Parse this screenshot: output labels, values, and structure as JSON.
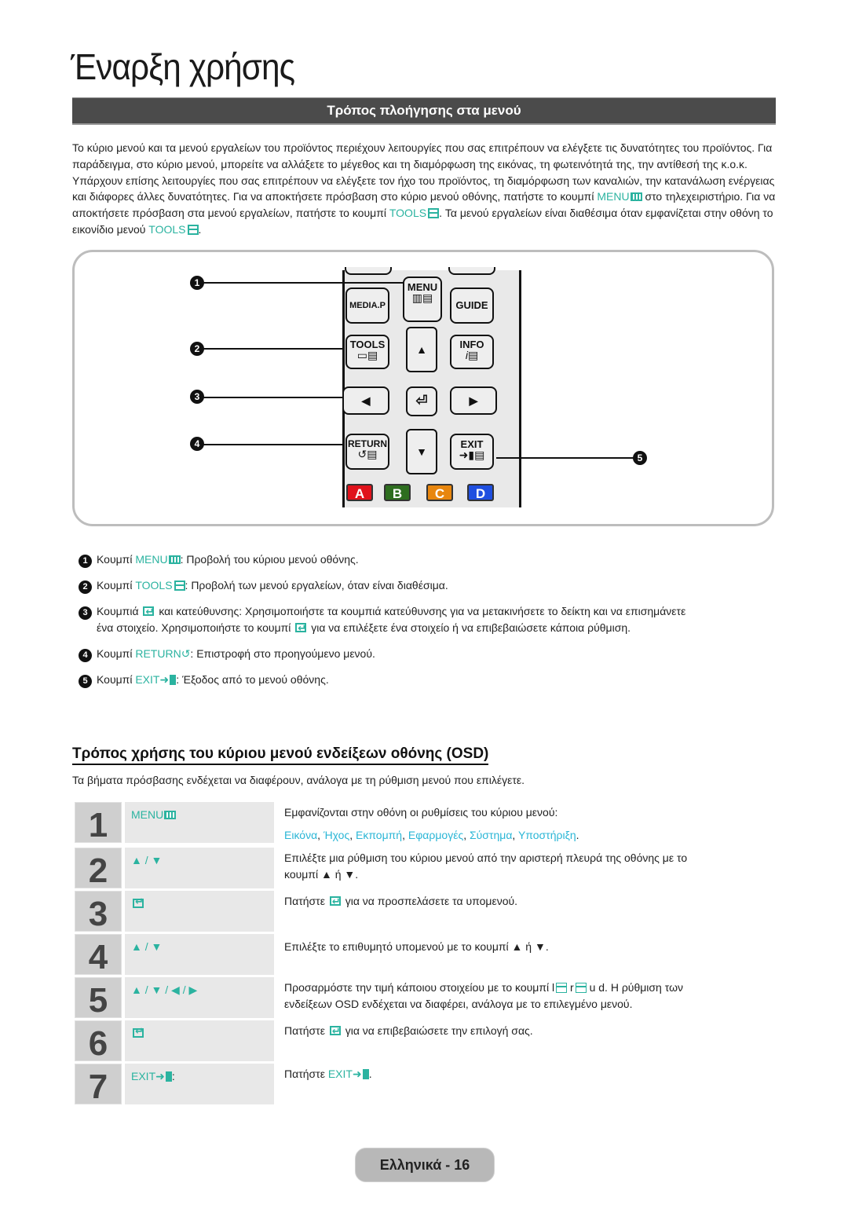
{
  "page": {
    "title": "Έναρξη χρήσης",
    "section_title": "Τρόπος πλοήγησης στα μενού",
    "page_label": "Ελληνικά - 16"
  },
  "intro": {
    "part1": "Το κύριο μενού και τα μενού εργαλείων του προϊόντος περιέχουν λειτουργίες που σας επιτρέπουν να ελέγξετε τις δυνατότητες του προϊόντος. Για παράδειγμα, στο κύριο μενού, μπορείτε να αλλάξετε το μέγεθος και τη διαμόρφωση της εικόνας, τη φωτεινότητά της, την αντίθεσή της κ.ο.κ. Υπάρχουν επίσης λειτουργίες που σας επιτρέπουν να ελέγξετε τον ήχο του προϊόντος, τη διαμόρφωση των καναλιών, την κατανάλωση ενέργειας και διάφορες άλλες δυνατότητες. Για να αποκτήσετε πρόσβαση στο κύριο μενού οθόνης, πατήστε το κουμπί ",
    "menu_key": "MENU",
    "part2": " στο τηλεχειριστήριο. Για να αποκτήσετε πρόσβαση στα μενού εργαλείων, πατήστε το κουμπί ",
    "tools_key": "TOOLS",
    "part3": ". Τα μενού εργαλείων είναι διαθέσιμα όταν εμφανίζεται στην οθόνη το εικονίδιο μενού ",
    "tools_key2": "TOOLS",
    "part4": "."
  },
  "remote": {
    "buttons": {
      "media_p": "MEDIA.P",
      "menu": "MENU",
      "guide": "GUIDE",
      "tools": "TOOLS",
      "info": "INFO",
      "return": "RETURN",
      "exit": "EXIT"
    },
    "color_buttons": [
      {
        "label": "A",
        "color": "#e0121b"
      },
      {
        "label": "B",
        "color": "#2e6e1f"
      },
      {
        "label": "C",
        "color": "#e8860e"
      },
      {
        "label": "D",
        "color": "#1f4fe0"
      }
    ],
    "callouts": [
      "1",
      "2",
      "3",
      "4",
      "5"
    ]
  },
  "legend": [
    {
      "num": "1",
      "prefix": "Κουμπί ",
      "key": "MENU",
      "text": ": Προβολή του κύριου μενού οθόνης."
    },
    {
      "num": "2",
      "prefix": "Κουμπί ",
      "key": "TOOLS",
      "text": ": Προβολή των μενού εργαλείων, όταν είναι διαθέσιμα."
    },
    {
      "num": "3",
      "prefix": "Κουμπιά ",
      "text": " και κατεύθυνσης: Χρησιμοποιήστε τα κουμπιά κατεύθυνσης για να μετακινήσετε το δείκτη και να επισημάνετε",
      "line2a": "ένα στοιχείο. Χρησιμοποιήστε το κουμπί ",
      "line2b": " για να επιλέξετε ένα στοιχείο ή να επιβεβαιώσετε κάποια ρύθμιση."
    },
    {
      "num": "4",
      "prefix": "Κουμπί ",
      "key": "RETURN",
      "text": ": Επιστροφή στο προηγούμενο μενού."
    },
    {
      "num": "5",
      "prefix": "Κουμπί ",
      "key": "EXIT",
      "text": ": Έξοδος από το μενού οθόνης."
    }
  ],
  "osd": {
    "heading": "Τρόπος χρήσης του κύριου μενού ενδείξεων οθόνης (OSD)",
    "note": "Τα βήματα πρόσβασης ενδέχεται να διαφέρουν, ανάλογα με τη ρύθμιση μενού που επιλέγετε.",
    "steps": [
      {
        "num": "1",
        "key": "MENU",
        "desc": "Εμφανίζονται στην οθόνη οι ρυθμίσεις του κύριου μενού:",
        "menu_items": [
          "Εικόνα",
          "Ήχος",
          "Εκπομπή",
          "Εφαρμογές",
          "Σύστημα",
          "Υποστήριξη"
        ]
      },
      {
        "num": "2",
        "key": "▲ / ▼",
        "desc": "Επιλέξτε μια ρύθμιση του κύριου μενού από την αριστερή πλευρά της οθόνης με το",
        "desc2": "κουμπί ▲ ή ▼."
      },
      {
        "num": "3",
        "key": "enter",
        "desc_a": "Πατήστε ",
        "desc_b": " για να προσπελάσετε τα υπομενού."
      },
      {
        "num": "4",
        "key": "▲ / ▼",
        "desc": "Επιλέξτε το επιθυμητό υπομενού με το κουμπί ▲ ή ▼."
      },
      {
        "num": "5",
        "key": "▲ / ▼ / ◀ / ▶",
        "desc": "Προσαρμόστε την τιμή κάποιου στοιχείου με το κουμπί l",
        "desc_mid": " r",
        "desc_end": " u    d. Η ρύθμιση των",
        "desc2": "ενδείξεων OSD ενδέχεται να διαφέρει, ανάλογα με το επιλεγμένο μενού."
      },
      {
        "num": "6",
        "key": "enter",
        "desc_a": "Πατήστε ",
        "desc_b": " για να επιβεβαιώσετε την επιλογή σας."
      },
      {
        "num": "7",
        "key": "EXIT",
        "key_suffix": ":",
        "desc_a": "Πατήστε ",
        "desc_key": "EXIT",
        "desc_b": "."
      }
    ]
  }
}
